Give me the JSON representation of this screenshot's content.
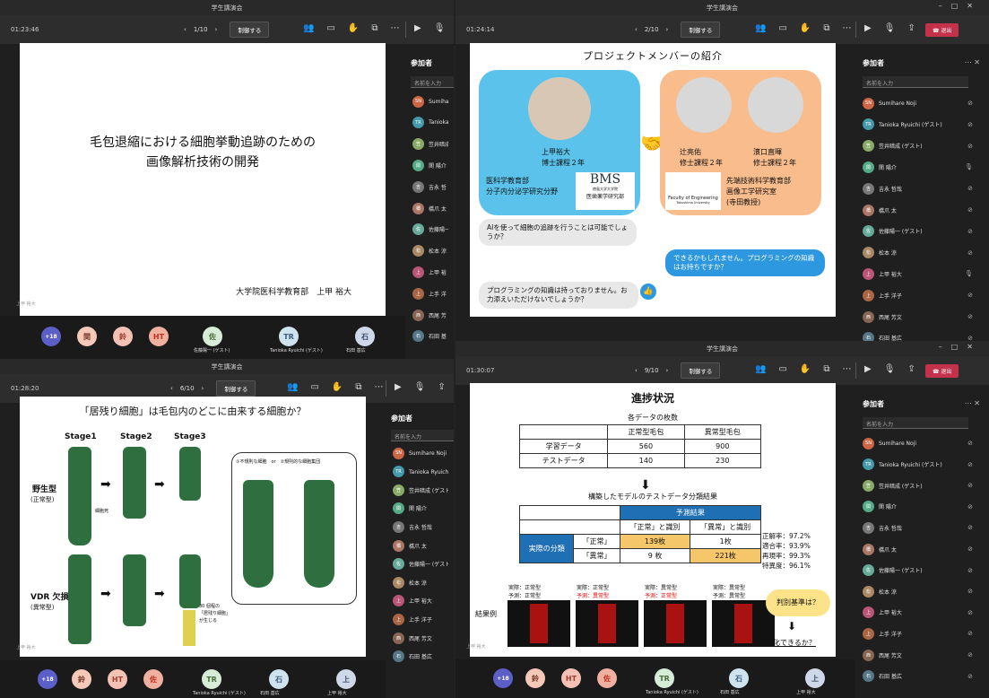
{
  "window_title": "学生講演会",
  "control_label": "制御する",
  "leave_label": "退出",
  "panel_title": "参加者",
  "search_placeholder": "名前を入力",
  "overflow_count": "+18",
  "q1": {
    "time": "01:23:46",
    "page": "1/10",
    "slide_title_1": "毛包退縮における細胞挙動追跡のための",
    "slide_title_2": "画像解析技術の開発",
    "slide_author": "大学院医科学教育部　上甲 裕大",
    "presenter": "上甲 裕大",
    "participants": [
      {
        "initial": "SN",
        "name": "Sumihar"
      },
      {
        "initial": "TR",
        "name": "Tanioka I"
      },
      {
        "initial": "笠",
        "name": "笠井暗成"
      },
      {
        "initial": "関",
        "name": "関 陽介"
      },
      {
        "initial": "吉",
        "name": "吉永 哲"
      },
      {
        "initial": "橋",
        "name": "橋爪 太"
      },
      {
        "initial": "佐",
        "name": "佐藤陽一"
      },
      {
        "initial": "松",
        "name": "松本 涼"
      },
      {
        "initial": "上",
        "name": "上甲 裕"
      },
      {
        "initial": "上",
        "name": "上手 洋"
      },
      {
        "initial": "西",
        "name": "西尾 芳"
      },
      {
        "initial": "石",
        "name": "石田 基"
      }
    ],
    "strip": [
      {
        "label": "関"
      },
      {
        "label": "鈴"
      },
      {
        "label": "HT"
      },
      {
        "label": "佐",
        "name": "佐藤陽一 (ゲスト)"
      },
      {
        "label": "TR",
        "name": "Tanioka Ryuichi (ゲスト)"
      },
      {
        "label": "石",
        "name": "石田 基広"
      }
    ]
  },
  "q2": {
    "time": "01:24:14",
    "page": "2/10",
    "slide_title": "プロジェクトメンバーの紹介",
    "left_person": "上甲裕大",
    "left_role": "博士課程２年",
    "left_dept1": "医科学教育部",
    "left_dept2": "分子内分泌学研究分野",
    "bms": "BMS",
    "bms_sub1": "徳島大学大学院",
    "bms_sub2": "医歯薬学研究部",
    "p2_name": "辻亮佑",
    "p2_role": "修士課程２年",
    "p3_name": "濱口直暉",
    "p3_role": "修士課程２年",
    "fe": "Faculty of Engineering",
    "fe_sub": "Tokushima University",
    "right_dept1": "先端技術科学教育部",
    "right_dept2": "画像工学研究室",
    "right_dept3": "(寺田教授)",
    "bubble1": "AIを使って細胞の追跡を行うことは可能でしょうか？",
    "bubble2": "できるかもしれません。プログラミングの知識はお持ちですか？",
    "bubble3": "プログラミングの知識は持っておりません。お力添えいただけないでしょうか？",
    "participants": [
      {
        "initial": "SN",
        "name": "Sumihare Noji",
        "mic": "off"
      },
      {
        "initial": "TR",
        "name": "Tanioka Ryuichi (ゲスト)",
        "mic": "off"
      },
      {
        "initial": "笠",
        "name": "笠井暗成 (ゲスト)",
        "mic": "off"
      },
      {
        "initial": "関",
        "name": "関 陽介",
        "mic": "on"
      },
      {
        "initial": "吉",
        "name": "吉永 哲哉",
        "mic": "off"
      },
      {
        "initial": "橋",
        "name": "橋爪 太",
        "mic": "off"
      },
      {
        "initial": "佐",
        "name": "佐藤陽一 (ゲスト)",
        "mic": "off"
      },
      {
        "initial": "松",
        "name": "松本 涼",
        "mic": "off"
      },
      {
        "initial": "上",
        "name": "上甲 裕大",
        "mic": "on"
      },
      {
        "initial": "上",
        "name": "上手 洋子",
        "mic": "off"
      },
      {
        "initial": "西",
        "name": "西尾 芳文",
        "mic": "off"
      },
      {
        "initial": "石",
        "name": "石田 基広",
        "mic": "off"
      }
    ]
  },
  "q3": {
    "time": "01:28:20",
    "page": "6/10",
    "slide_title": "「居残り細胞」は毛包内のどこに由来する細胞か？",
    "stage1": "Stage1",
    "stage2": "Stage2",
    "stage3": "Stage3",
    "wild": "野生型",
    "wild_sub": "(正常型)",
    "death": "細胞死",
    "vdr": "VDR 欠損",
    "vdr_sub": "(異常型)",
    "option": "①不規則な細胞　or　②規則的な細胞集団",
    "note1": "30 個程の",
    "note2": "「居残り細胞」",
    "note3": "が生じる",
    "presenter": "上甲 裕大",
    "participants": [
      {
        "initial": "SN",
        "name": "Sumihare Noji"
      },
      {
        "initial": "TR",
        "name": "Tanioka Ryuichi (ゲ"
      },
      {
        "initial": "笠",
        "name": "笠井暗成 (ゲスト)"
      },
      {
        "initial": "関",
        "name": "関 陽介"
      },
      {
        "initial": "吉",
        "name": "吉永 哲哉"
      },
      {
        "initial": "橋",
        "name": "橋爪 太"
      },
      {
        "initial": "佐",
        "name": "佐藤陽一 (ゲスト)"
      },
      {
        "initial": "松",
        "name": "松本 涼"
      },
      {
        "initial": "上",
        "name": "上甲 裕大"
      },
      {
        "initial": "上",
        "name": "上手 洋子"
      },
      {
        "initial": "西",
        "name": "西尾 芳文"
      },
      {
        "initial": "石",
        "name": "石田 基広"
      }
    ],
    "strip": [
      {
        "label": "鈴"
      },
      {
        "label": "HT"
      },
      {
        "label": "佐"
      },
      {
        "label": "TR",
        "name": "Tanioka Ryuichi (ゲスト)"
      },
      {
        "label": "石",
        "name": "石田 基広"
      },
      {
        "label": "上",
        "name": "上甲 裕大"
      }
    ]
  },
  "q4": {
    "time": "01:30:07",
    "page": "9/10",
    "slide_title": "進捗状況",
    "sub1": "各データの枚数",
    "col1": "正常型毛包",
    "col2": "異常型毛包",
    "row1": "学習データ",
    "row2": "テストデータ",
    "v11": "560",
    "v12": "900",
    "v21": "140",
    "v22": "230",
    "sub2": "構築したモデルのテストデータ分類結果",
    "pred": "予測結果",
    "pc1": "「正常」と識別",
    "pc2": "「異常」と識別",
    "actual": "実際の分類",
    "ar1": "「正常」",
    "ar2": "「異常」",
    "c11": "139枚",
    "c12": "1枚",
    "c21": "9 枚",
    "c22": "221枚",
    "m1": "正解率：97.2%",
    "m2": "適合率：93.9%",
    "m3": "再現率：99.3%",
    "m4": "特異度：96.1%",
    "ex": "結果例",
    "e1a": "実際：正常型",
    "e1b": "予測：正常型",
    "e2a": "実際：正常型",
    "e2b": "予測：異常型",
    "e3a": "実際：異常型",
    "e3b": "予測：正常型",
    "e4a": "実際：異常型",
    "e4b": "予測：異常型",
    "cloud": "判別基準は？",
    "viz": "可視化できるか？",
    "presenter": "上甲 裕大",
    "participants": [
      {
        "initial": "SN",
        "name": "Sumihare Noji"
      },
      {
        "initial": "TR",
        "name": "Tanioka Ryuichi (ゲスト)"
      },
      {
        "initial": "笠",
        "name": "笠井暗成 (ゲスト)"
      },
      {
        "initial": "関",
        "name": "関 陽介"
      },
      {
        "initial": "吉",
        "name": "吉永 哲哉"
      },
      {
        "initial": "橋",
        "name": "橋爪 太"
      },
      {
        "initial": "佐",
        "name": "佐藤陽一 (ゲスト)"
      },
      {
        "initial": "松",
        "name": "松本 涼"
      },
      {
        "initial": "上",
        "name": "上甲 裕大"
      },
      {
        "initial": "上",
        "name": "上手 洋子"
      },
      {
        "initial": "西",
        "name": "西尾 芳文"
      },
      {
        "initial": "石",
        "name": "石田 基広"
      }
    ],
    "strip": [
      {
        "label": "鈴"
      },
      {
        "label": "HT"
      },
      {
        "label": "佐"
      },
      {
        "label": "TR",
        "name": "Tanioka Ryuichi (ゲスト)"
      },
      {
        "label": "石",
        "name": "石田 基広"
      },
      {
        "label": "上",
        "name": "上甲 裕大"
      }
    ]
  }
}
